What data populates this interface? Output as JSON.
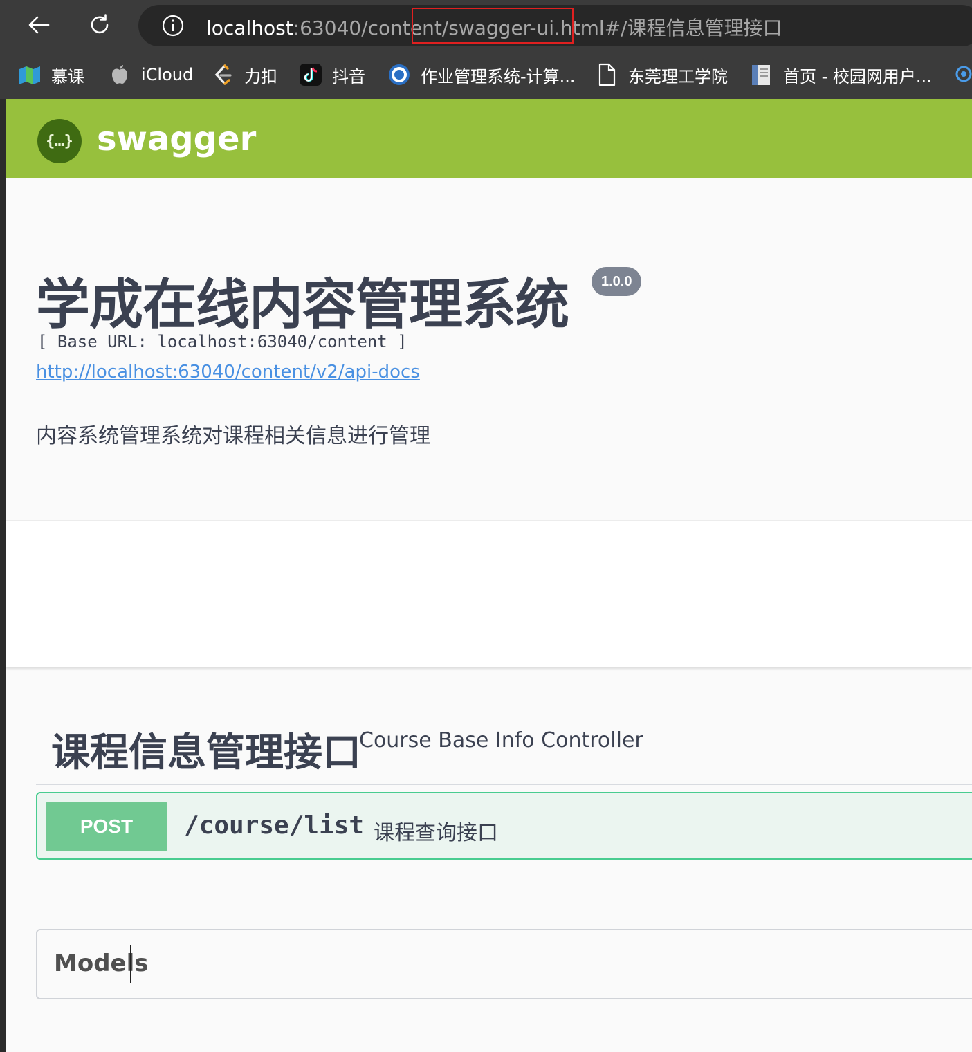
{
  "browser": {
    "url_host": "localhost",
    "url_rest": ":63040/content/swagger-ui.html#/课程信息管理接口",
    "bookmarks": [
      {
        "label": "慕课",
        "icon": "map-book-icon"
      },
      {
        "label": "iCloud",
        "icon": "apple-icon"
      },
      {
        "label": "力扣",
        "icon": "leetcode-icon"
      },
      {
        "label": "抖音",
        "icon": "tiktok-icon"
      },
      {
        "label": "作业管理系统-计算...",
        "icon": "school-seal-icon"
      },
      {
        "label": "东莞理工学院",
        "icon": "page-icon"
      },
      {
        "label": "首页 - 校园网用户...",
        "icon": "document-icon"
      }
    ]
  },
  "swagger": {
    "logo_text": "swagger",
    "logo_glyph": "{…}"
  },
  "info": {
    "title": "学成在线内容管理系统",
    "version": "1.0.0",
    "base_url": "[ Base URL: localhost:63040/content ]",
    "docs_link": "http://localhost:63040/content/v2/api-docs",
    "description": "内容系统管理系统对课程相关信息进行管理"
  },
  "tag": {
    "name": "课程信息管理接口",
    "description": "Course Base Info Controller"
  },
  "operation": {
    "method": "POST",
    "path": "/course/list",
    "summary": "课程查询接口"
  },
  "models": {
    "title": "Models"
  },
  "colors": {
    "topbar": "#97c03d",
    "post": "#71c992",
    "post_bg": "#ebf5f0",
    "link": "#4990e2",
    "highlight": "#e02020"
  }
}
